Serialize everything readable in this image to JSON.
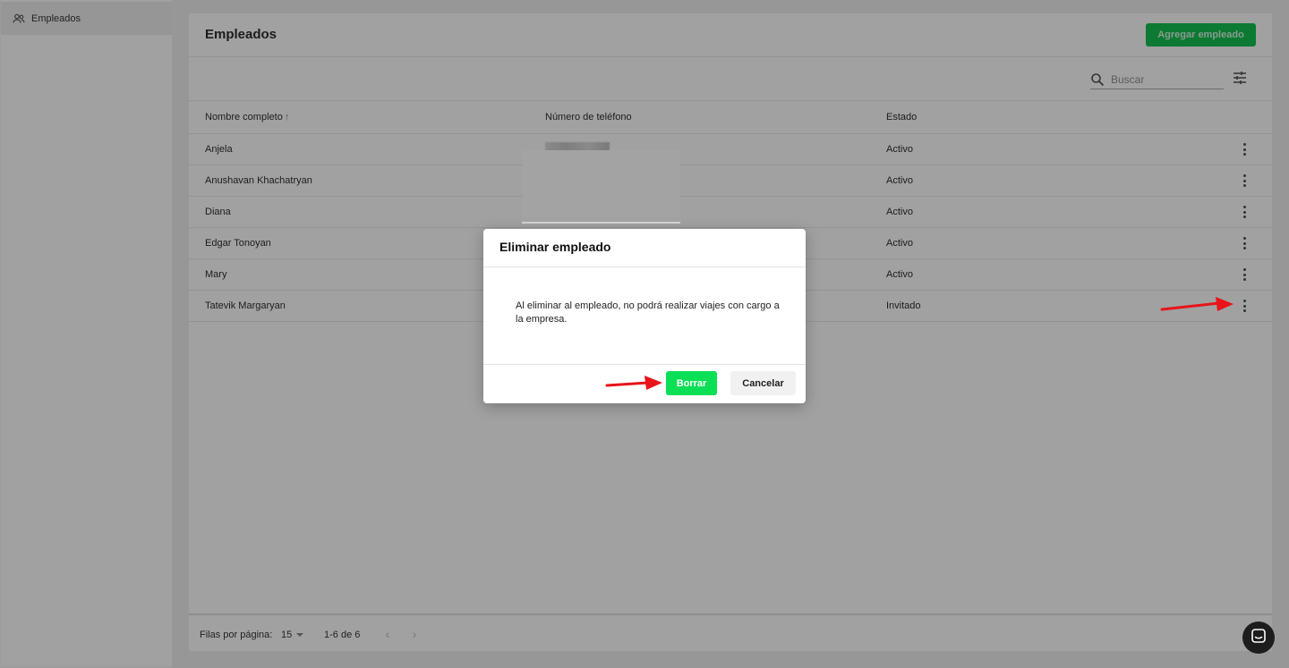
{
  "sidebar": {
    "items": [
      {
        "label": "Empleados",
        "icon": "users-icon"
      }
    ]
  },
  "header": {
    "title": "Empleados",
    "add_button_label": "Agregar empleado"
  },
  "toolbar": {
    "search_placeholder": "Buscar",
    "search_value": ""
  },
  "table": {
    "columns": [
      "Nombre completo",
      "Número de teléfono",
      "Estado"
    ],
    "sort_indicator": "↑",
    "rows": [
      {
        "name": "Anjela",
        "status": "Activo"
      },
      {
        "name": "Anushavan Khachatryan",
        "status": "Activo"
      },
      {
        "name": "Diana",
        "status": "Activo"
      },
      {
        "name": "Edgar Tonoyan",
        "status": "Activo"
      },
      {
        "name": "Mary",
        "status": "Activo"
      },
      {
        "name": "Tatevik Margaryan",
        "status": "Invitado"
      }
    ]
  },
  "footer": {
    "rows_per_page_label": "Filas por página:",
    "rows_per_page_value": "15",
    "range_text": "1-6 de 6",
    "prev_glyph": "‹",
    "next_glyph": "›"
  },
  "modal": {
    "title": "Eliminar empleado",
    "body": "Al eliminar al empleado, no podrá realizar viajes con cargo a la empresa.",
    "delete_label": "Borrar",
    "cancel_label": "Cancelar"
  },
  "colors": {
    "accent_green": "#0adf55",
    "annotation_red": "#e8141a"
  }
}
